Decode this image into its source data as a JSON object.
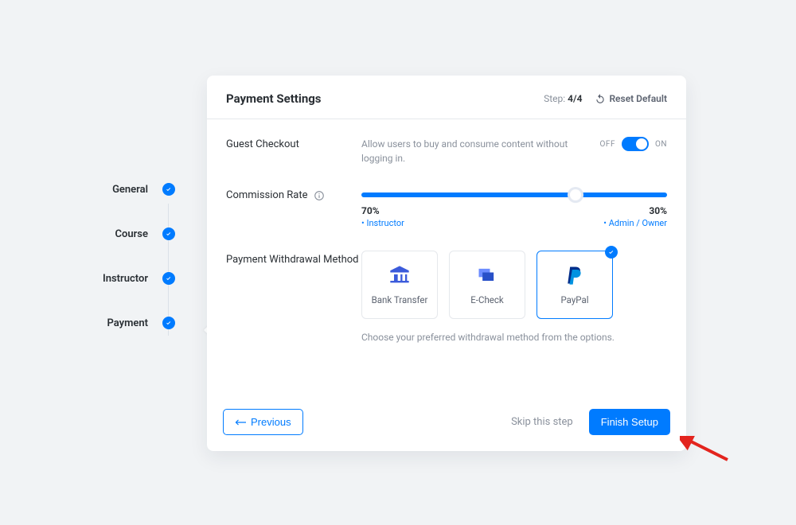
{
  "wizard": {
    "steps": [
      {
        "label": "General",
        "completed": true
      },
      {
        "label": "Course",
        "completed": true
      },
      {
        "label": "Instructor",
        "completed": true
      },
      {
        "label": "Payment",
        "completed": true,
        "current": true
      }
    ]
  },
  "header": {
    "title": "Payment Settings",
    "step_prefix": "Step:",
    "step_value": "4/4",
    "reset_label": "Reset Default"
  },
  "guest_checkout": {
    "label": "Guest Checkout",
    "help": "Allow users to buy and consume content without logging in.",
    "off_label": "OFF",
    "on_label": "ON",
    "enabled": true
  },
  "commission": {
    "label": "Commission Rate",
    "instructor_pct": "70%",
    "instructor_role": "Instructor",
    "admin_pct": "30%",
    "admin_role": "Admin / Owner",
    "instructor_share": 70
  },
  "withdrawal": {
    "label": "Payment Withdrawal Method",
    "help": "Choose your preferred withdrawal method from the options.",
    "methods": [
      {
        "key": "bank",
        "label": "Bank Transfer",
        "selected": false
      },
      {
        "key": "echeck",
        "label": "E-Check",
        "selected": false
      },
      {
        "key": "paypal",
        "label": "PayPal",
        "selected": true
      }
    ]
  },
  "footer": {
    "previous": "Previous",
    "skip": "Skip this step",
    "finish": "Finish Setup"
  }
}
